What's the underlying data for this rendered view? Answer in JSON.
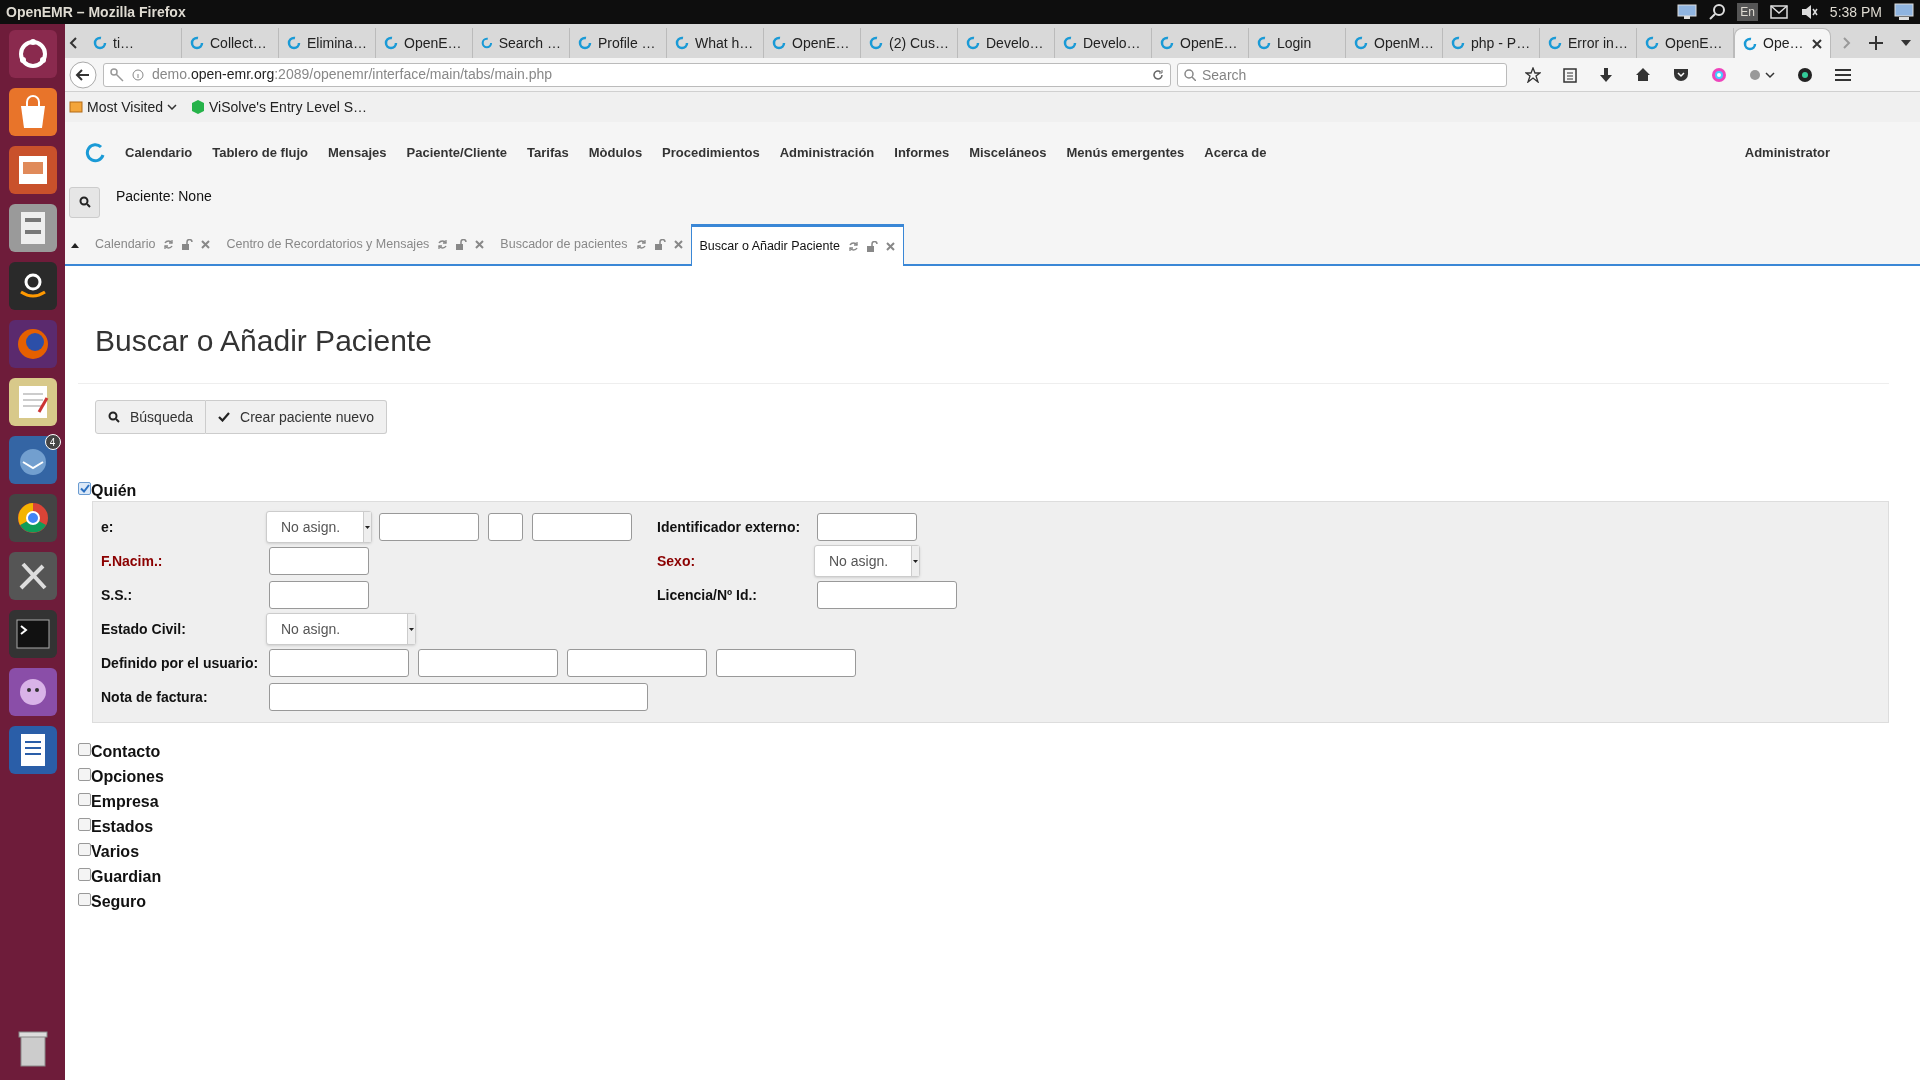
{
  "os_bar": {
    "title": "OpenEMR – Mozilla Firefox",
    "keyboard": "En",
    "clock": "5:38 PM"
  },
  "launcher": {
    "mail_badge": "4"
  },
  "browser": {
    "tabs": [
      {
        "label": "ti…",
        "selected": false
      },
      {
        "label": "Collect…",
        "selected": false
      },
      {
        "label": "Elimina…",
        "selected": false
      },
      {
        "label": "OpenE…",
        "selected": false
      },
      {
        "label": "Search …",
        "selected": false
      },
      {
        "label": "Profile …",
        "selected": false
      },
      {
        "label": "What h…",
        "selected": false
      },
      {
        "label": "OpenE…",
        "selected": false
      },
      {
        "label": "(2) Cus…",
        "selected": false
      },
      {
        "label": "Develo…",
        "selected": false
      },
      {
        "label": "Develo…",
        "selected": false
      },
      {
        "label": "OpenE…",
        "selected": false
      },
      {
        "label": "Login",
        "selected": false
      },
      {
        "label": "OpenM…",
        "selected": false
      },
      {
        "label": "php - P…",
        "selected": false
      },
      {
        "label": "Error in…",
        "selected": false
      },
      {
        "label": "OpenE…",
        "selected": false
      },
      {
        "label": "Ope…",
        "selected": true
      }
    ],
    "url": "demo.**open-emr.org**:2089/openemr/interface/main/tabs/main.php",
    "search": {
      "placeholder": "Search"
    },
    "bookmarks": [
      "Most Visited",
      "ViSolve's Entry Level S…"
    ]
  },
  "app": {
    "menu": [
      "Calendario",
      "Tablero de flujo",
      "Mensajes",
      "Paciente/Cliente",
      "Tarifas",
      "Mòdulos",
      "Procedimientos",
      "Administración",
      "Informes",
      "Misceláneos",
      "Menús emergentes",
      "Acerca de"
    ],
    "user": "Administrator",
    "patient": "Paciente: None",
    "tabs": [
      {
        "label": "Calendario",
        "selected": false
      },
      {
        "label": "Centro de Recordatorios y Mensajes",
        "selected": false
      },
      {
        "label": "Buscador de pacientes",
        "selected": false
      },
      {
        "label": "Buscar o Añadir Paciente",
        "selected": true
      }
    ]
  },
  "page": {
    "title": "Buscar o Añadir Paciente",
    "buttons": [
      "Búsqueda",
      "Crear paciente nuevo"
    ],
    "sections": [
      {
        "label": "Quién",
        "checked": true,
        "rows": [
          {
            "left": {
              "label": "e:",
              "required": false,
              "controls": [
                {
                  "kind": "select",
                  "value": "No asign."
                },
                {
                  "kind": "field"
                },
                {
                  "kind": "tiny"
                },
                {
                  "kind": "field"
                }
              ]
            },
            "right": {
              "label": "Identificador externo:",
              "required": false,
              "controls": [
                {
                  "kind": "field"
                }
              ]
            }
          },
          {
            "left": {
              "label": "F.Nacim.:",
              "required": true,
              "controls": [
                {
                  "kind": "field"
                }
              ]
            },
            "right": {
              "label": "Sexo:",
              "required": true,
              "controls": [
                {
                  "kind": "select",
                  "value": "No asign."
                }
              ]
            }
          },
          {
            "left": {
              "label": "S.S.:",
              "required": false,
              "controls": [
                {
                  "kind": "field"
                }
              ]
            },
            "right": {
              "label": "Licencia/Nº Id.:",
              "required": false,
              "controls": [
                {
                  "kind": "wide"
                }
              ]
            }
          },
          {
            "left": {
              "label": "Estado Civil:",
              "required": false,
              "controls": [
                {
                  "kind": "select-wide",
                  "value": "No asign."
                }
              ]
            }
          },
          {
            "left": {
              "label": "Definido por el usuario:",
              "required": false,
              "controls": [
                {
                  "kind": "wide"
                },
                {
                  "kind": "wide"
                },
                {
                  "kind": "wide"
                },
                {
                  "kind": "wide"
                }
              ]
            }
          },
          {
            "left": {
              "label": "Nota de factura:",
              "required": false,
              "controls": [
                {
                  "kind": "long"
                }
              ]
            }
          }
        ]
      },
      {
        "label": "Contacto",
        "checked": false
      },
      {
        "label": "Opciones",
        "checked": false
      },
      {
        "label": "Empresa",
        "checked": false
      },
      {
        "label": "Estados",
        "checked": false
      },
      {
        "label": "Varios",
        "checked": false
      },
      {
        "label": "Guardian",
        "checked": false
      },
      {
        "label": "Seguro",
        "checked": false
      }
    ]
  }
}
